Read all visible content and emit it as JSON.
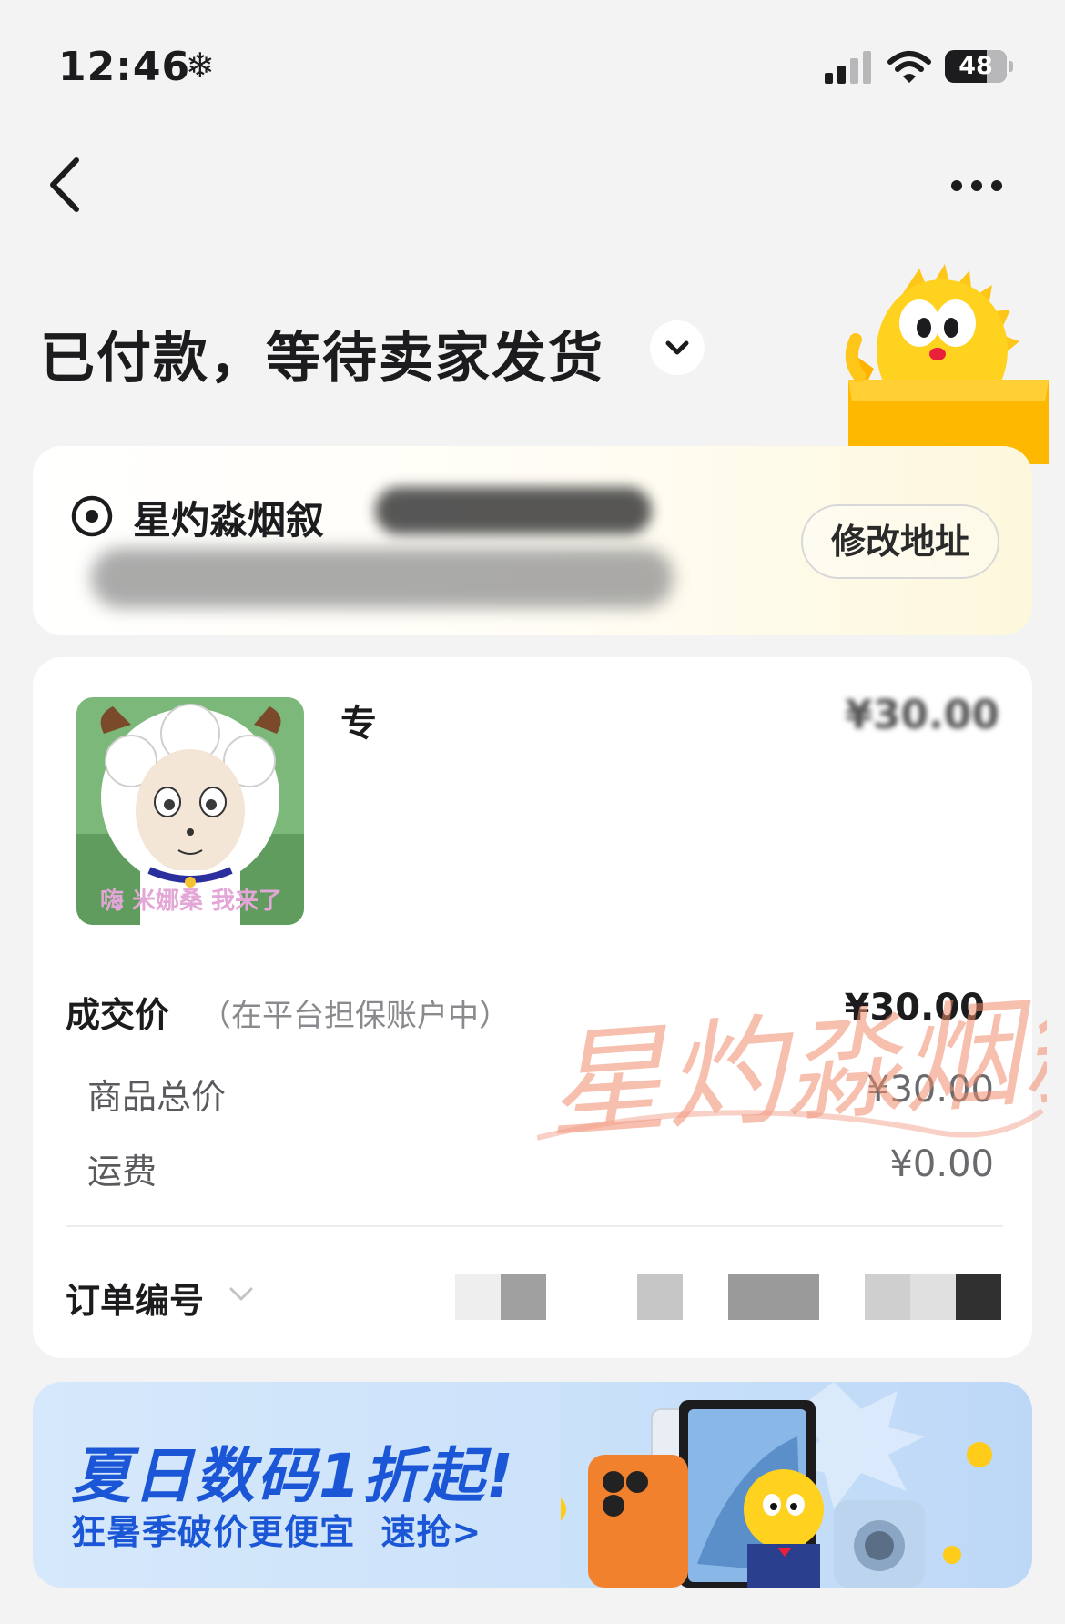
{
  "status_bar": {
    "time": "12:46",
    "time_icon": "snowflake-icon",
    "battery_level": "48"
  },
  "nav": {
    "back_icon": "chevron-left-icon",
    "more_icon": "more-dots-icon"
  },
  "order_status": {
    "title": "已付款，等待卖家发货",
    "expand_icon": "chevron-down-icon"
  },
  "address": {
    "icon": "location-pin-icon",
    "name": "星灼淼烟叙",
    "edit_button_label": "修改地址"
  },
  "product": {
    "image_caption": "嗨 米娜桑 我来了",
    "title": "专",
    "price": "¥30.00"
  },
  "pricing": {
    "deal_label": "成交价",
    "deal_note": "（在平台担保账户中）",
    "deal_value": "¥30.00",
    "subtotal_label": "商品总价",
    "subtotal_value": "¥30.00",
    "shipping_label": "运费",
    "shipping_value": "¥0.00"
  },
  "order_number": {
    "label": "订单编号",
    "expand_icon": "chevron-down-icon"
  },
  "watermark_text": "星灼淼烟叙",
  "promo": {
    "title": "夏日数码1折起!",
    "subtitle": "狂暑季破价更便宜",
    "cta": "速抢>"
  },
  "colors": {
    "background": "#f3f3f4",
    "promo_blue": "#1a56d6",
    "mascot_yellow": "#ffd21f"
  }
}
